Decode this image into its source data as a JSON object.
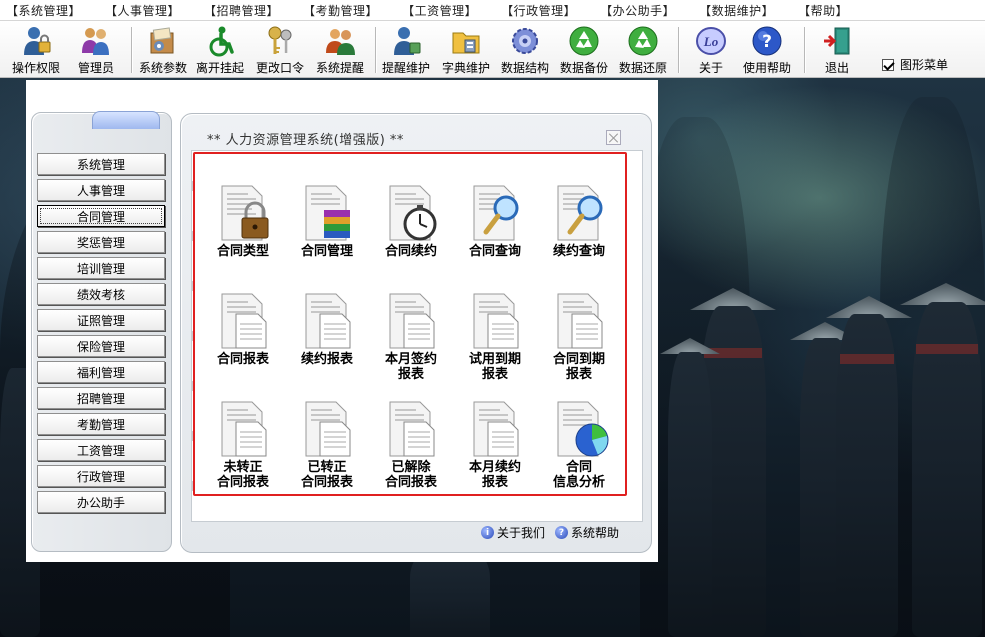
{
  "menubar": {
    "items": [
      "【系统管理】",
      "【人事管理】",
      "【招聘管理】",
      "【考勤管理】",
      "【工资管理】",
      "【行政管理】",
      "【办公助手】",
      "【数据维护】",
      "【帮助】"
    ]
  },
  "toolbar": {
    "buttons": [
      {
        "label": "操作权限",
        "icon": "user-lock-icon"
      },
      {
        "label": "管理员",
        "icon": "admin-users-icon"
      },
      {
        "label": "系统参数",
        "icon": "settings-folder-icon"
      },
      {
        "label": "离开挂起",
        "icon": "wheelchair-icon"
      },
      {
        "label": "更改口令",
        "icon": "keys-icon"
      },
      {
        "label": "系统提醒",
        "icon": "people-reminder-icon"
      },
      {
        "label": "提醒维护",
        "icon": "reminder-user-icon"
      },
      {
        "label": "字典维护",
        "icon": "dictionary-folder-icon"
      },
      {
        "label": "数据结构",
        "icon": "gear-structure-icon"
      },
      {
        "label": "数据备份",
        "icon": "recycle-backup-icon"
      },
      {
        "label": "数据还原",
        "icon": "recycle-restore-icon"
      },
      {
        "label": "关于",
        "icon": "about-logo-icon"
      },
      {
        "label": "使用帮助",
        "icon": "help-icon"
      },
      {
        "label": "退出",
        "icon": "exit-door-icon"
      }
    ],
    "graphic_menu_label": "图形菜单",
    "graphic_menu_checked": true
  },
  "nav": {
    "items": [
      "系统管理",
      "人事管理",
      "合同管理",
      "奖惩管理",
      "培训管理",
      "绩效考核",
      "证照管理",
      "保险管理",
      "福利管理",
      "招聘管理",
      "考勤管理",
      "工资管理",
      "行政管理",
      "办公助手"
    ],
    "active": "合同管理"
  },
  "content": {
    "title": "**  人力资源管理系统(增强版)  **",
    "items": [
      {
        "label": "合同类型",
        "icon": "document-lock-icon"
      },
      {
        "label": "合同管理",
        "icon": "document-books-icon"
      },
      {
        "label": "合同续约",
        "icon": "document-stopwatch-icon"
      },
      {
        "label": "合同查询",
        "icon": "document-magnifier-icon"
      },
      {
        "label": "续约查询",
        "icon": "document-magnifier-icon"
      },
      {
        "label": "合同报表",
        "icon": "document-report-icon"
      },
      {
        "label": "续约报表",
        "icon": "document-report-icon"
      },
      {
        "label": "本月签约\n报表",
        "icon": "document-report-icon"
      },
      {
        "label": "试用到期\n报表",
        "icon": "document-report-icon"
      },
      {
        "label": "合同到期\n报表",
        "icon": "document-report-icon"
      },
      {
        "label": "未转正\n合同报表",
        "icon": "document-report-icon"
      },
      {
        "label": "已转正\n合同报表",
        "icon": "document-report-icon"
      },
      {
        "label": "已解除\n合同报表",
        "icon": "document-report-icon"
      },
      {
        "label": "本月续约\n报表",
        "icon": "document-report-icon"
      },
      {
        "label": "合同\n信息分析",
        "icon": "document-piechart-icon"
      }
    ],
    "footer": [
      {
        "label": "关于我们",
        "icon": "about-icon"
      },
      {
        "label": "系统帮助",
        "icon": "help-icon"
      }
    ]
  }
}
